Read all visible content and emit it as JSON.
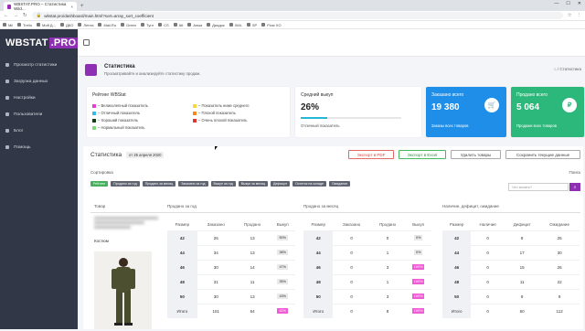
{
  "browser": {
    "tab_title": "WBSTAT.PRO – Статистика Wild...",
    "url": "wbstat.pro/dashboard/main.html?sort=array_sort_coefficient",
    "bookmarks": [
      "Mil",
      "Trello",
      "Мой Д...",
      "ДБО",
      "Лента",
      "Mail.Ru",
      "Green",
      "Тугл",
      "CS",
      "Alt",
      "Альм",
      "Диадок",
      "XML",
      "SP",
      "Flow XO"
    ]
  },
  "brand": {
    "name": "WBSTAT",
    "suffix": ".PRO",
    "accent": "#8f2fb4",
    "sidebar_bg": "#323747"
  },
  "sidebar": {
    "items": [
      {
        "label": "Просмотр статистики",
        "icon": "chart-icon"
      },
      {
        "label": "Загрузка данных",
        "icon": "upload-icon"
      },
      {
        "label": "Настройки",
        "icon": "gear-icon"
      },
      {
        "label": "Пользователи",
        "icon": "users-icon"
      },
      {
        "label": "Блог",
        "icon": "blog-icon"
      },
      {
        "label": "Помощь",
        "icon": "help-icon"
      }
    ]
  },
  "page": {
    "title": "Статистика",
    "subtitle": "Просматривайте и анализируйте статистику продаж.",
    "breadcrumb": "⌂ / Статистика"
  },
  "rating": {
    "title": "Рейтинг WBStat",
    "legend": [
      {
        "label": "– Великолепный показатель",
        "color": "#e040d0"
      },
      {
        "label": "– Отличный показатель",
        "color": "#3fb7e6"
      },
      {
        "label": "– Хороший показатель",
        "color": "#123e14"
      },
      {
        "label": "– Нормальный показатель",
        "color": "#7ed97e"
      },
      {
        "label": "– Показатель ниже среднего",
        "color": "#f3d93a"
      },
      {
        "label": "– Плохой показатель",
        "color": "#f28a1c"
      },
      {
        "label": "– Очень плохой показатель",
        "color": "#e03333"
      }
    ]
  },
  "kpis": {
    "buyout": {
      "label": "Средний выкуп",
      "value": "26%",
      "progress": 0.26,
      "sub": "Отличный показатель"
    },
    "ordered": {
      "label": "Заказано всего",
      "value": "19 380",
      "sub": "Заказы всех товаров",
      "color": "#1e8ee8"
    },
    "sold": {
      "label": "Продано всего",
      "value": "5 064",
      "sub": "Продажи всех товаров",
      "color": "#2cb87a"
    }
  },
  "stats": {
    "title": "Статистика",
    "date": "от 25 апреля 2020",
    "buttons": {
      "pdf": "Экспорт в PDF",
      "excel": "Экспорт в Excel",
      "delete": "Удалить товары",
      "save": "Сохранить текущие данные"
    },
    "sort_label": "Сортировка",
    "search_label": "Поиск",
    "search_placeholder": "Что искать?",
    "chips": [
      "Рейтинг",
      "Продано за год",
      "Продано за месяц",
      "Заказано за год",
      "Выкуп за год",
      "Выкуп за месяц",
      "Дефицит",
      "Остаток на складе",
      "Ожидание"
    ],
    "sections": {
      "product": "Товар",
      "year": "Продано за год",
      "month": "Продано за месяц",
      "stock": "Наличие, дефицит, ожидание"
    },
    "product_category": "Костюм"
  },
  "tables": {
    "year": {
      "headers": [
        "Размер",
        "Заказано",
        "Продано",
        "Выкуп"
      ],
      "rows": [
        [
          "42",
          "26",
          "13",
          "50%"
        ],
        [
          "44",
          "34",
          "13",
          "38%"
        ],
        [
          "46",
          "30",
          "14",
          "47%"
        ],
        [
          "48",
          "31",
          "11",
          "35%"
        ],
        [
          "50",
          "30",
          "13",
          "43%"
        ],
        [
          "Итого",
          "151",
          "64",
          "42%"
        ]
      ]
    },
    "month": {
      "headers": [
        "Размер",
        "Заказано",
        "Продано",
        "Выкуп"
      ],
      "rows": [
        [
          "42",
          "0",
          "0",
          "0%"
        ],
        [
          "44",
          "0",
          "1",
          "0%"
        ],
        [
          "46",
          "0",
          "3",
          "100%"
        ],
        [
          "48",
          "0",
          "1",
          "100%"
        ],
        [
          "50",
          "0",
          "3",
          "100%"
        ],
        [
          "Итого",
          "0",
          "8",
          "100%"
        ]
      ]
    },
    "stock": {
      "headers": [
        "Размер",
        "Наличие",
        "Дефицит",
        "Ожидание"
      ],
      "rows": [
        [
          "42",
          "0",
          "8",
          "25"
        ],
        [
          "44",
          "0",
          "17",
          "30"
        ],
        [
          "46",
          "0",
          "15",
          "26"
        ],
        [
          "48",
          "0",
          "11",
          "22"
        ],
        [
          "50",
          "0",
          "9",
          "9"
        ],
        [
          "Итого",
          "0",
          "60",
          "112"
        ]
      ]
    }
  }
}
